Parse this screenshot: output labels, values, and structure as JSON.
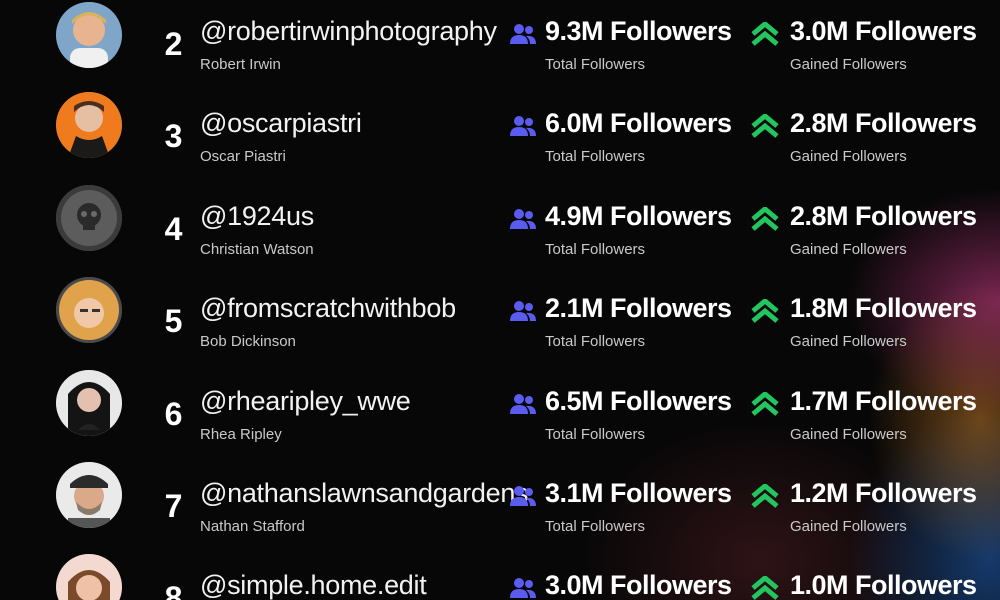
{
  "colors": {
    "total_icon": "#5a5cf0",
    "gain_icon": "#22c55e"
  },
  "rows": [
    {
      "rank": "2",
      "handle": "@robertirwinphotography",
      "name": "Robert Irwin",
      "total": "9.3M Followers",
      "total_label": "Total Followers",
      "gained": "3.0M Followers",
      "gained_label": "Gained Followers"
    },
    {
      "rank": "3",
      "handle": "@oscarpiastri",
      "name": "Oscar Piastri",
      "total": "6.0M Followers",
      "total_label": "Total Followers",
      "gained": "2.8M Followers",
      "gained_label": "Gained Followers"
    },
    {
      "rank": "4",
      "handle": "@1924us",
      "name": "Christian Watson",
      "total": "4.9M Followers",
      "total_label": "Total Followers",
      "gained": "2.8M Followers",
      "gained_label": "Gained Followers"
    },
    {
      "rank": "5",
      "handle": "@fromscratchwithbob",
      "name": "Bob Dickinson",
      "total": "2.1M Followers",
      "total_label": "Total Followers",
      "gained": "1.8M Followers",
      "gained_label": "Gained Followers"
    },
    {
      "rank": "6",
      "handle": "@rhearipley_wwe",
      "name": "Rhea Ripley",
      "total": "6.5M Followers",
      "total_label": "Total Followers",
      "gained": "1.7M Followers",
      "gained_label": "Gained Followers"
    },
    {
      "rank": "7",
      "handle": "@nathanslawnsandgardens",
      "name": "Nathan Stafford",
      "total": "3.1M Followers",
      "total_label": "Total Followers",
      "gained": "1.2M Followers",
      "gained_label": "Gained Followers"
    },
    {
      "rank": "8",
      "handle": "@simple.home.edit",
      "name": "",
      "total": "3.0M Followers",
      "total_label": "",
      "gained": "1.0M Followers",
      "gained_label": ""
    }
  ]
}
